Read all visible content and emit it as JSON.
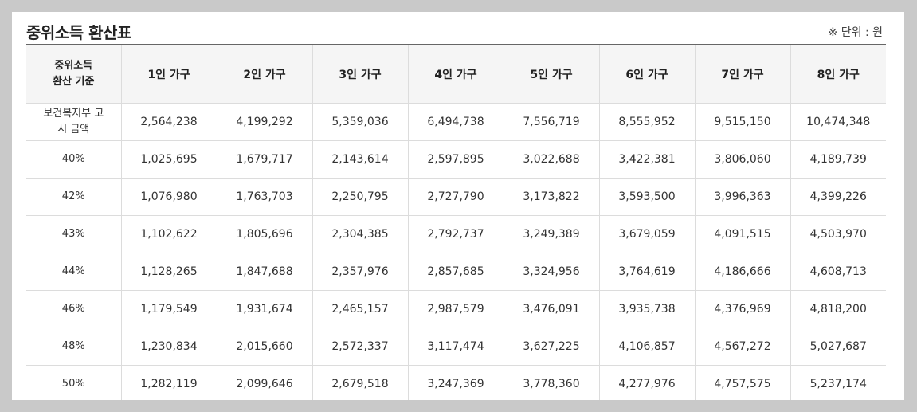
{
  "title": "중위소득 환산표",
  "unit": "※ 단위 : 원",
  "header": {
    "corner_line1": "중위소득",
    "corner_line2": "환산 기준",
    "columns": [
      "1인 가구",
      "2인 가구",
      "3인 가구",
      "4인 가구",
      "5인 가구",
      "6인 가구",
      "7인 가구",
      "8인 가구"
    ]
  },
  "rows": [
    {
      "label1": "보건복지부 고",
      "label2": "시 금액",
      "values": [
        "2,564,238",
        "4,199,292",
        "5,359,036",
        "6,494,738",
        "7,556,719",
        "8,555,952",
        "9,515,150",
        "10,474,348"
      ]
    },
    {
      "label1": "40%",
      "label2": "",
      "values": [
        "1,025,695",
        "1,679,717",
        "2,143,614",
        "2,597,895",
        "3,022,688",
        "3,422,381",
        "3,806,060",
        "4,189,739"
      ]
    },
    {
      "label1": "42%",
      "label2": "",
      "values": [
        "1,076,980",
        "1,763,703",
        "2,250,795",
        "2,727,790",
        "3,173,822",
        "3,593,500",
        "3,996,363",
        "4,399,226"
      ]
    },
    {
      "label1": "43%",
      "label2": "",
      "values": [
        "1,102,622",
        "1,805,696",
        "2,304,385",
        "2,792,737",
        "3,249,389",
        "3,679,059",
        "4,091,515",
        "4,503,970"
      ]
    },
    {
      "label1": "44%",
      "label2": "",
      "values": [
        "1,128,265",
        "1,847,688",
        "2,357,976",
        "2,857,685",
        "3,324,956",
        "3,764,619",
        "4,186,666",
        "4,608,713"
      ]
    },
    {
      "label1": "46%",
      "label2": "",
      "values": [
        "1,179,549",
        "1,931,674",
        "2,465,157",
        "2,987,579",
        "3,476,091",
        "3,935,738",
        "4,376,969",
        "4,818,200"
      ]
    },
    {
      "label1": "48%",
      "label2": "",
      "values": [
        "1,230,834",
        "2,015,660",
        "2,572,337",
        "3,117,474",
        "3,627,225",
        "4,106,857",
        "4,567,272",
        "5,027,687"
      ]
    },
    {
      "label1": "50%",
      "label2": "",
      "values": [
        "1,282,119",
        "2,099,646",
        "2,679,518",
        "3,247,369",
        "3,778,360",
        "4,277,976",
        "4,757,575",
        "5,237,174"
      ]
    }
  ]
}
